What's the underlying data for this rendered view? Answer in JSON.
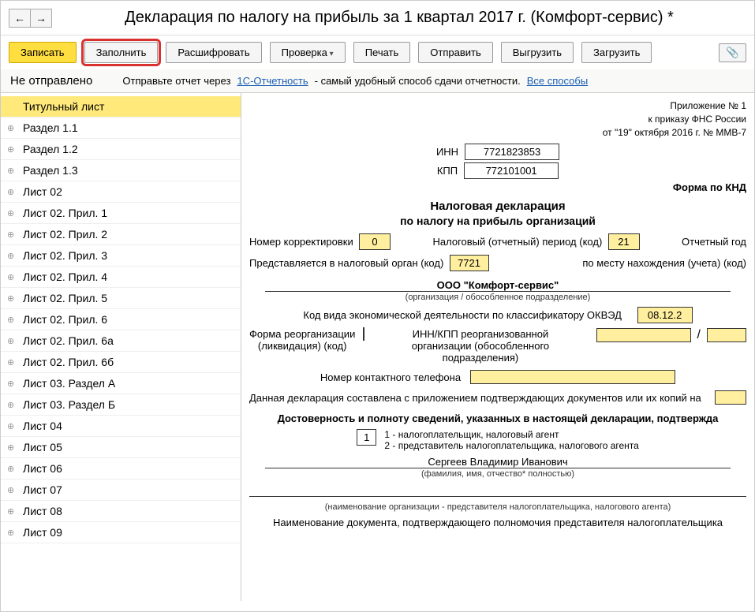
{
  "header": {
    "title": "Декларация по налогу на прибыль за 1 квартал 2017 г. (Комфорт-сервис) *"
  },
  "toolbar": {
    "write": "Записать",
    "fill": "Заполнить",
    "decode": "Расшифровать",
    "check": "Проверка",
    "print": "Печать",
    "send": "Отправить",
    "upload": "Выгрузить",
    "download": "Загрузить"
  },
  "status": {
    "state": "Не отправлено",
    "msg1": "Отправьте отчет через ",
    "link1": "1С-Отчетность",
    "msg2": " - самый удобный способ сдачи отчетности. ",
    "link2": "Все способы"
  },
  "sidebar": {
    "items": [
      "Титульный лист",
      "Раздел 1.1",
      "Раздел 1.2",
      "Раздел 1.3",
      "Лист 02",
      "Лист 02. Прил. 1",
      "Лист 02. Прил. 2",
      "Лист 02. Прил. 3",
      "Лист 02. Прил. 4",
      "Лист 02. Прил. 5",
      "Лист 02. Прил. 6",
      "Лист 02. Прил. 6а",
      "Лист 02. Прил. 6б",
      "Лист 03. Раздел А",
      "Лист 03. Раздел Б",
      "Лист 04",
      "Лист 05",
      "Лист 06",
      "Лист 07",
      "Лист 08",
      "Лист 09"
    ]
  },
  "form": {
    "top_note1": "Приложение № 1",
    "top_note2": "к приказу ФНС России",
    "top_note3": "от \"19\" октября 2016 г. № ММВ-7",
    "inn_label": "ИНН",
    "inn": "7721823853",
    "kpp_label": "КПП",
    "kpp": "772101001",
    "knd_label": "Форма по КНД",
    "title": "Налоговая декларация",
    "subtitle": "по налогу на прибыль организаций",
    "corr_label": "Номер корректировки",
    "corr": "0",
    "period_label": "Налоговый (отчетный) период (код)",
    "period": "21",
    "year_label": "Отчетный год",
    "authority_label": "Представляется в налоговый орган (код)",
    "authority": "7721",
    "place_label": "по месту нахождения (учета) (код)",
    "org": "ООО \"Комфорт-сервис\"",
    "org_hint": "(организация / обособленное подразделение)",
    "okved_label": "Код вида экономической деятельности по классификатору ОКВЭД",
    "okved": "08.12.2",
    "reorg_label1": "Форма реорганизации",
    "reorg_label2": "(ликвидация) (код)",
    "reorg_inn_label1": "ИНН/КПП реорганизованной",
    "reorg_inn_label2": "организации (обособленного",
    "reorg_inn_label3": "подразделения)",
    "phone_label": "Номер контактного телефона",
    "docs_label": "Данная декларация составлена с приложением подтверждающих документов или их копий на",
    "confirm_title": "Достоверность и полноту сведений, указанных в настоящей декларации, подтвержда",
    "signer_code": "1",
    "signer_desc1": "1 - налогоплательщик, налоговый агент",
    "signer_desc2": "2 - представитель налогоплательщика, налогового агента",
    "person": "Сергеев Владимир Иванович",
    "person_hint": "(фамилия, имя, отчество* полностью)",
    "rep_org_hint": "(наименование организации - представителя налогоплательщика, налогового агента)",
    "doc_confirm": "Наименование документа, подтверждающего полномочия представителя налогоплательщика"
  }
}
